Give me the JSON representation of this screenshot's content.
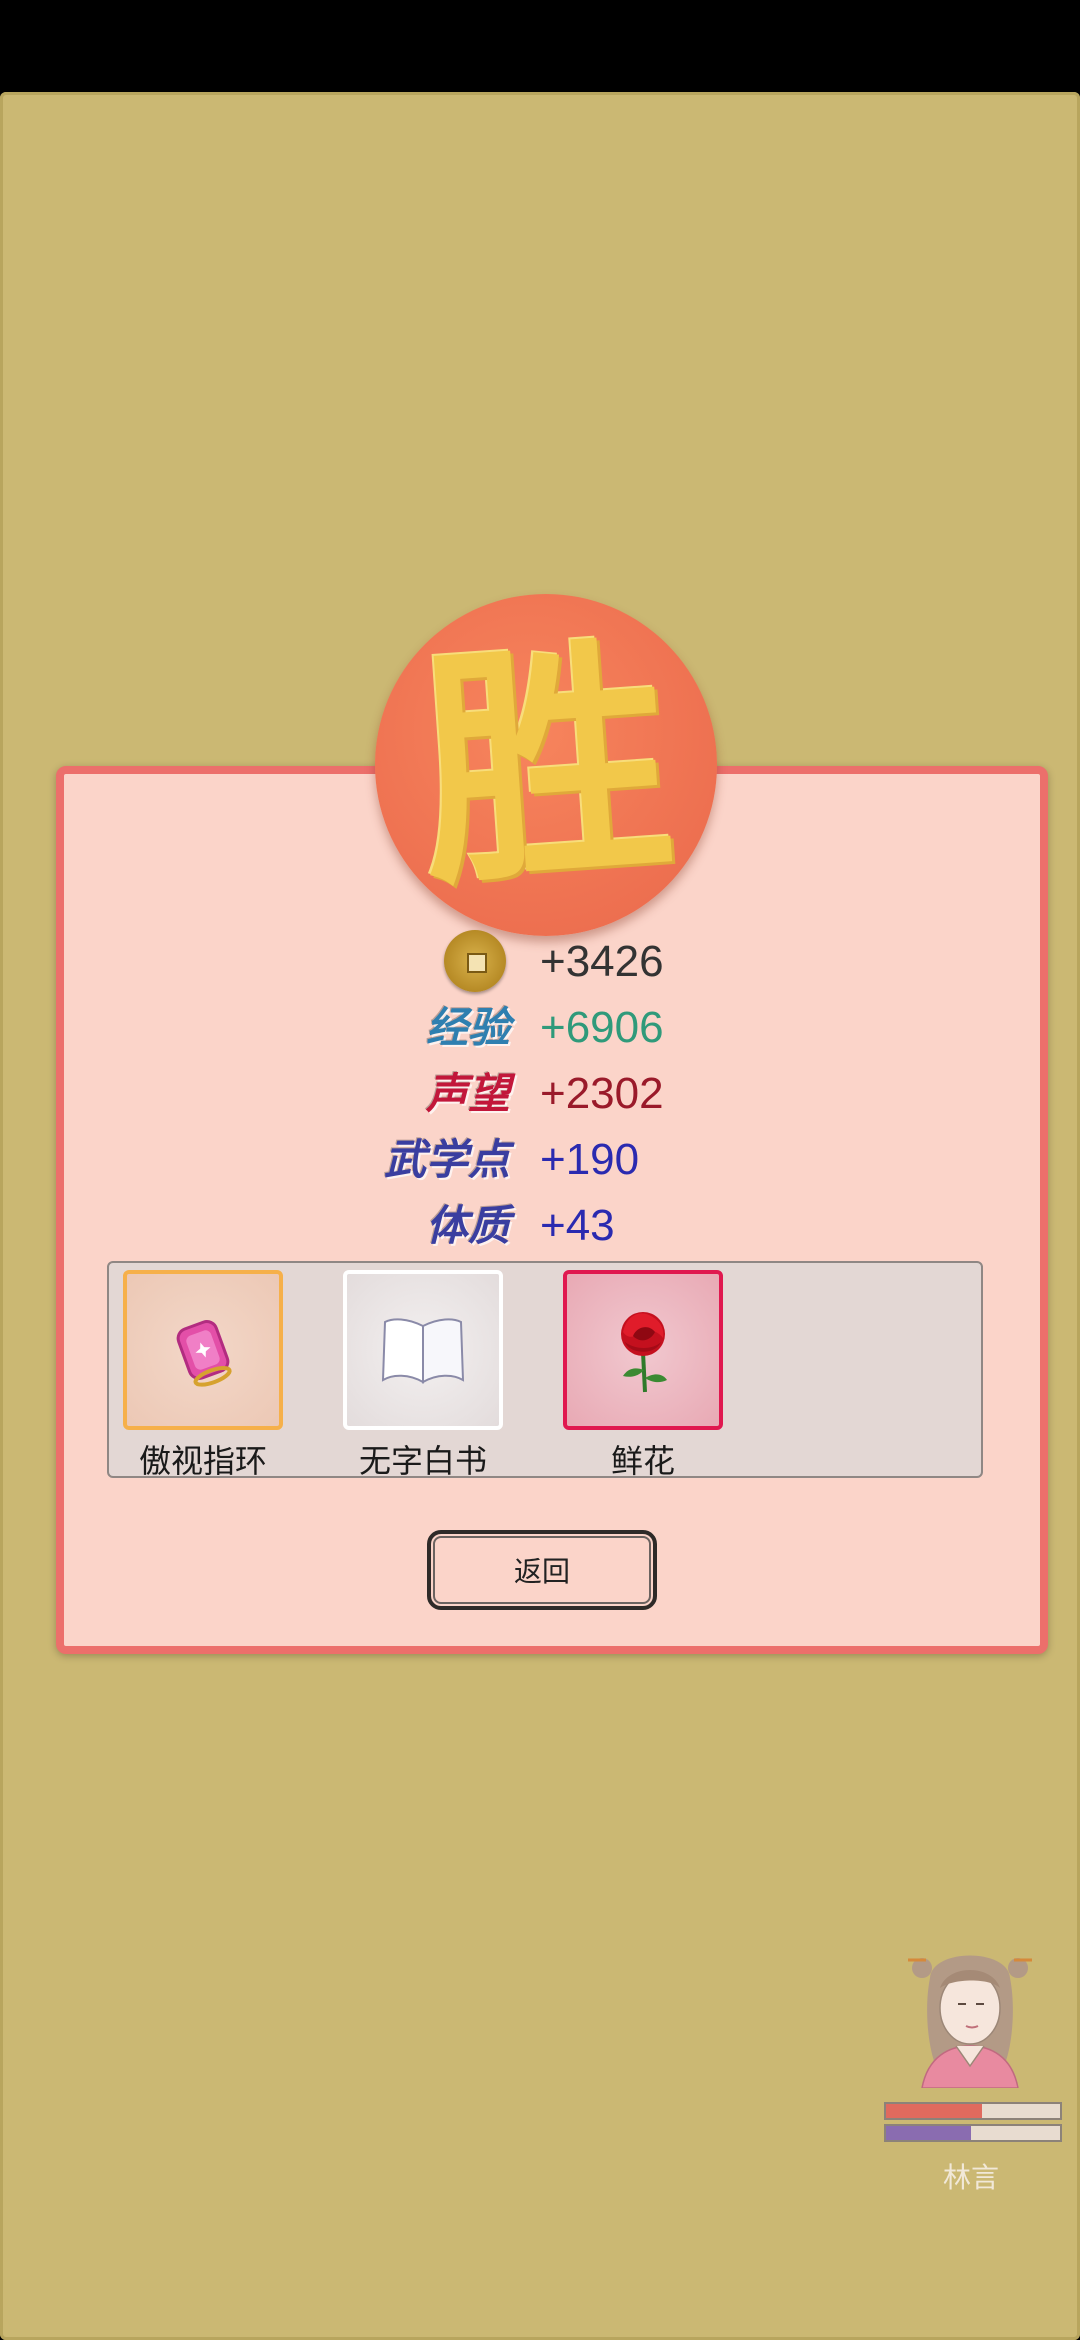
{
  "result": {
    "title_glyph": "胜"
  },
  "rewards": [
    {
      "label": "",
      "icon": "coin-icon",
      "value": "+3426",
      "label_color": "#6b4a14",
      "value_color": "#333333"
    },
    {
      "label": "经验",
      "icon": "",
      "value": "+6906",
      "label_color": "#2f7fb0",
      "value_color": "#2f9a7a"
    },
    {
      "label": "声望",
      "icon": "",
      "value": "+2302",
      "label_color": "#c2173a",
      "value_color": "#9a1a2a"
    },
    {
      "label": "武学点",
      "icon": "",
      "value": "+190",
      "label_color": "#3a3ea0",
      "value_color": "#2a2ab0"
    },
    {
      "label": "体质",
      "icon": "",
      "value": "+43",
      "label_color": "#3a3ea0",
      "value_color": "#2a2ab0"
    }
  ],
  "items": [
    {
      "name": "傲视指环",
      "icon": "ring-icon",
      "frame_color": "#f6b04a"
    },
    {
      "name": "无字白书",
      "icon": "book-icon",
      "frame_color": "#ffffff"
    },
    {
      "name": "鲜花",
      "icon": "rose-icon",
      "frame_color": "#e0184f"
    }
  ],
  "back_button": {
    "label": "返回"
  },
  "character": {
    "name": "林言",
    "hp_fraction": 0.55,
    "mp_fraction": 0.49,
    "hp_color": "#e06a5e",
    "mp_color": "#8a6cb0"
  }
}
